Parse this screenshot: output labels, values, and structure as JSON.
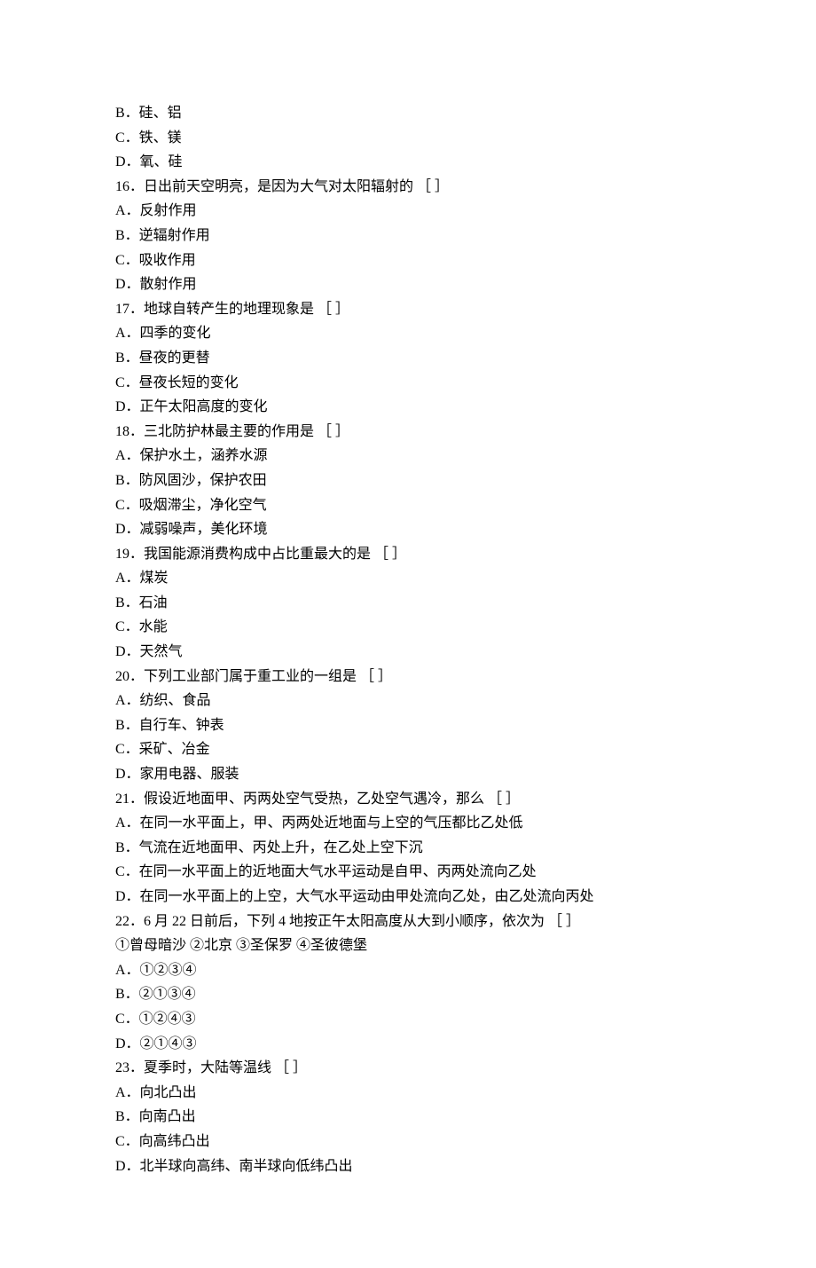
{
  "lines": [
    "B．硅、铝",
    "C．铁、镁",
    "D．氧、硅",
    "16．日出前天空明亮，是因为大气对太阳辐射的 ［ ］",
    "A．反射作用",
    "B．逆辐射作用",
    "C．吸收作用",
    "D．散射作用",
    "17．地球自转产生的地理现象是  ［ ］",
    "A．四季的变化",
    "B．昼夜的更替",
    "C．昼夜长短的变化",
    "D．正午太阳高度的变化",
    "18．三北防护林最主要的作用是  ［ ］",
    "A．保护水土，涵养水源",
    "B．防风固沙，保护农田",
    "C．吸烟滞尘，净化空气",
    "D．减弱噪声，美化环境",
    "19．我国能源消费构成中占比重最大的是  ［ ］",
    "A．煤炭",
    "B．石油",
    "C．水能",
    "D．天然气",
    "20．下列工业部门属于重工业的一组是 ［ ］",
    "A．纺织、食品",
    "B．自行车、钟表",
    "C．采矿、冶金",
    "D．家用电器、服装",
    "21．假设近地面甲、丙两处空气受热，乙处空气遇冷，那么  ［ ］",
    "A．在同一水平面上，甲、丙两处近地面与上空的气压都比乙处低",
    "B．气流在近地面甲、丙处上升，在乙处上空下沉",
    "C．在同一水平面上的近地面大气水平运动是自甲、丙两处流向乙处",
    "D．在同一水平面上的上空，大气水平运动由甲处流向乙处，由乙处流向丙处",
    "22．6 月 22 日前后，下列 4 地按正午太阳高度从大到小顺序，依次为  ［ ］",
    "①曾母暗沙 ②北京 ③圣保罗 ④圣彼德堡",
    "A．①②③④",
    "B．②①③④",
    "C．①②④③",
    "D．②①④③",
    "23．夏季时，大陆等温线 ［ ］",
    "A．向北凸出",
    "B．向南凸出",
    "C．向高纬凸出",
    "D．北半球向高纬、南半球向低纬凸出"
  ]
}
